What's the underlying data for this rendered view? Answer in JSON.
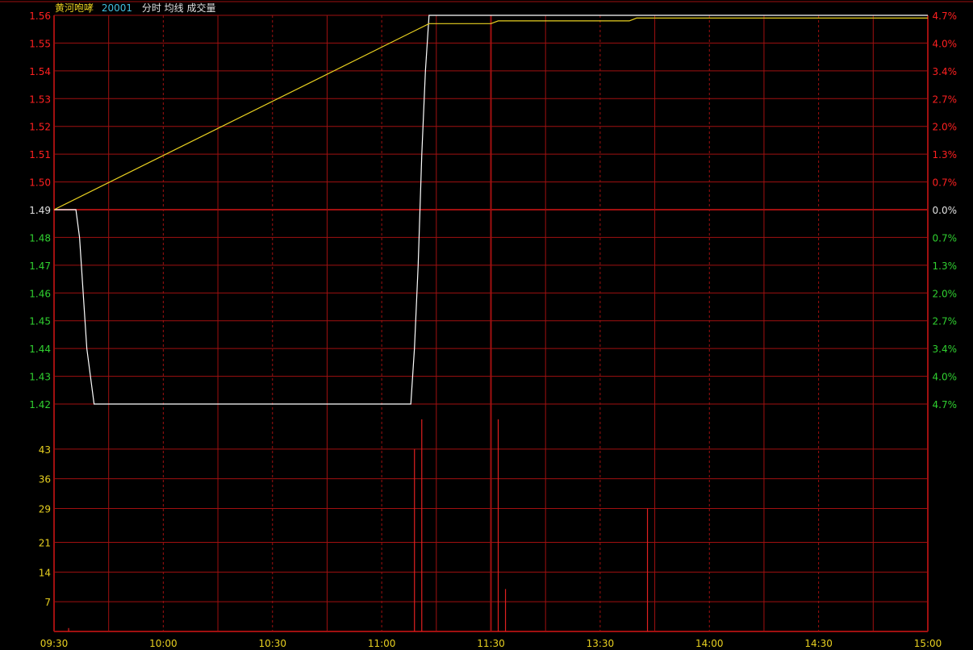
{
  "header": {
    "stock_name": "黄河咆哮",
    "stock_code": "20001",
    "indicators": "分时 均线 成交量"
  },
  "colors": {
    "background": "#000000",
    "grid": "#a01010",
    "up": "#ff2020",
    "down": "#30d030",
    "flat": "#e0e0e0",
    "volume_axis": "#e8d020",
    "price_line": "#ffffff",
    "avg_line": "#e8d020",
    "volume_bar": "#e02020",
    "name": "#e8d020",
    "code": "#40c0e0"
  },
  "chart_data": {
    "type": "line",
    "prev_close": 1.49,
    "time_ticks": [
      "09:30",
      "10:00",
      "10:30",
      "11:00",
      "11:30",
      "13:30",
      "14:00",
      "14:30",
      "15:00"
    ],
    "price_axis": {
      "ticks": [
        "1.56",
        "1.55",
        "1.54",
        "1.53",
        "1.52",
        "1.51",
        "1.50",
        "1.49",
        "1.48",
        "1.47",
        "1.46",
        "1.45",
        "1.44",
        "1.43",
        "1.42"
      ],
      "ylim": [
        1.42,
        1.56
      ]
    },
    "percent_axis": {
      "ticks": [
        "4.7%",
        "4.0%",
        "3.4%",
        "2.7%",
        "2.0%",
        "1.3%",
        "0.7%",
        "0.0%",
        "0.7%",
        "1.3%",
        "2.0%",
        "2.7%",
        "3.4%",
        "4.0%",
        "4.7%"
      ]
    },
    "volume_axis": {
      "ticks": [
        "43",
        "36",
        "29",
        "21",
        "14",
        "7"
      ],
      "ylim": [
        0,
        50
      ]
    },
    "series": [
      {
        "key": "price",
        "points": [
          [
            0,
            1.49
          ],
          [
            6,
            1.49
          ],
          [
            7,
            1.48
          ],
          [
            8,
            1.46
          ],
          [
            9,
            1.44
          ],
          [
            10,
            1.43
          ],
          [
            11,
            1.42
          ],
          [
            98,
            1.42
          ],
          [
            99,
            1.44
          ],
          [
            100,
            1.47
          ],
          [
            101,
            1.51
          ],
          [
            102,
            1.54
          ],
          [
            103,
            1.56
          ],
          [
            240,
            1.56
          ]
        ]
      },
      {
        "key": "avg",
        "points": [
          [
            0,
            1.49
          ],
          [
            103,
            1.557
          ],
          [
            120,
            1.557
          ],
          [
            122,
            1.558
          ],
          [
            158,
            1.558
          ],
          [
            160,
            1.559
          ],
          [
            240,
            1.559
          ]
        ]
      }
    ],
    "volume": [
      [
        4,
        0.8
      ],
      [
        99,
        43
      ],
      [
        101,
        50
      ],
      [
        122,
        50
      ],
      [
        124,
        10
      ],
      [
        163,
        29
      ]
    ]
  }
}
